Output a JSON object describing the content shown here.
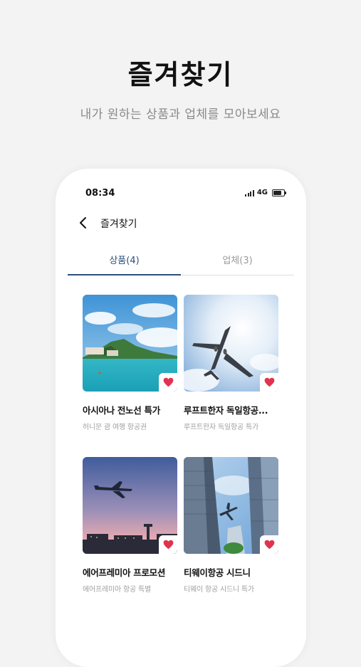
{
  "hero": {
    "title": "즐겨찾기",
    "subtitle": "내가 원하는 상품과 업체를 모아보세요"
  },
  "status_bar": {
    "time": "08:34",
    "network": "4G"
  },
  "nav": {
    "title": "즐겨찾기"
  },
  "tabs": [
    {
      "label": "상품(4)",
      "active": true
    },
    {
      "label": "업체(3)",
      "active": false
    }
  ],
  "favorites": [
    {
      "title": "아시아나 전노선 특가",
      "subtitle": "허니문 괌 여행 항공권",
      "image": "island-coast-photo"
    },
    {
      "title": "루프트한자 독일항공...",
      "subtitle": "루프트한자 독일항공 특가",
      "image": "airplane-sky-photo"
    },
    {
      "title": "에어프레미아 프로모션",
      "subtitle": "에어프레미아 항공 특별",
      "image": "airplane-sunset-photo"
    },
    {
      "title": "티웨이항공 시드니",
      "subtitle": "티웨이 항공 시드니 특가",
      "image": "airplane-skyscrapers-photo"
    }
  ],
  "colors": {
    "accent": "#2c4f7c",
    "heart": "#e0334f",
    "background": "#f3f3f3"
  }
}
